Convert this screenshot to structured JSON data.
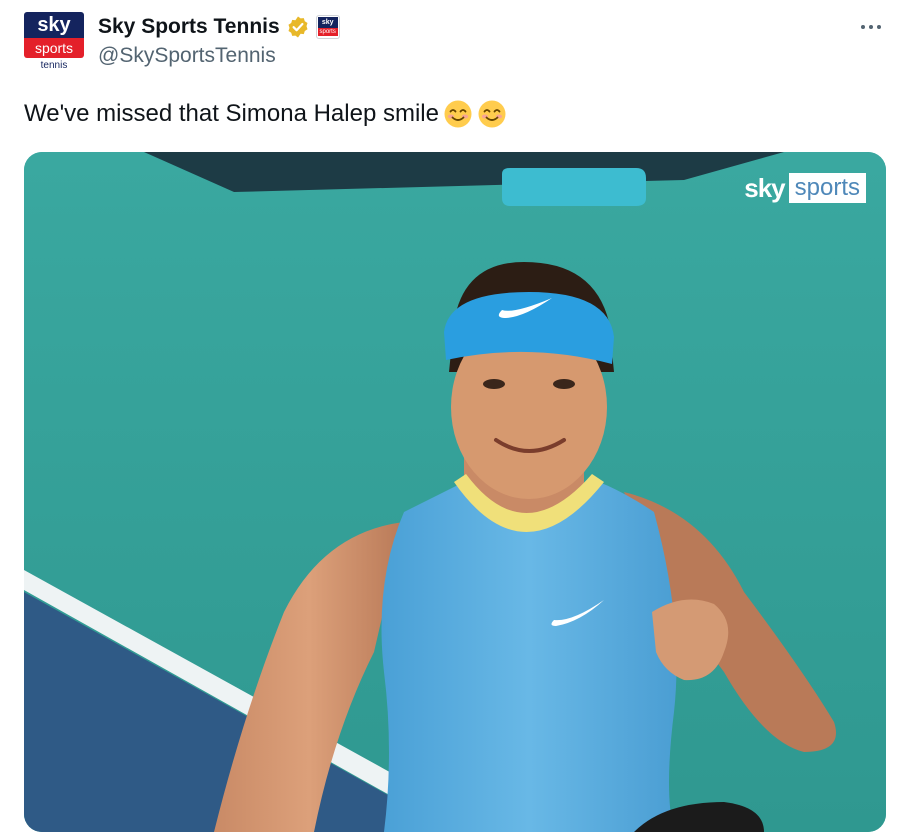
{
  "account": {
    "display_name": "Sky Sports Tennis",
    "handle": "@SkySportsTennis",
    "avatar": {
      "line1": "sky",
      "line2": "sports",
      "line3": "tennis"
    },
    "affiliate_badge": {
      "line1": "sky",
      "line2": "sports"
    }
  },
  "tweet": {
    "text": "We've missed that Simona Halep smile",
    "emojis": [
      "smiling-face-with-smiling-eyes-icon",
      "smiling-face-with-smiling-eyes-icon"
    ]
  },
  "media": {
    "watermark": {
      "part1": "sky",
      "part2": "sports"
    }
  },
  "icons": {
    "verified": "verified-gold-check-icon",
    "more": "more-options-icon"
  },
  "colors": {
    "court": "#34a29a",
    "verified_gold": "#e8b829",
    "sky_navy": "#14245e",
    "sky_red": "#e4202a",
    "visor_blue": "#2a9ee0",
    "dress_blue": "#5fb2e3"
  }
}
